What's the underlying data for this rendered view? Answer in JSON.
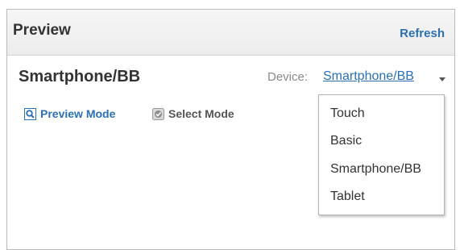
{
  "header": {
    "title": "Preview",
    "refresh_label": "Refresh"
  },
  "profile": {
    "title": "Smartphone/BB"
  },
  "device": {
    "label": "Device:",
    "value": "Smartphone/BB"
  },
  "modes": [
    {
      "label": "Preview Mode",
      "icon": "magnifier-icon"
    },
    {
      "label": "Select Mode",
      "icon": "select-cursor-icon"
    }
  ],
  "dropdown": {
    "options": [
      "Touch",
      "Basic",
      "Smartphone/BB",
      "Tablet"
    ]
  },
  "colors": {
    "accent": "#2b6fb5",
    "phone_body": "#111111"
  }
}
